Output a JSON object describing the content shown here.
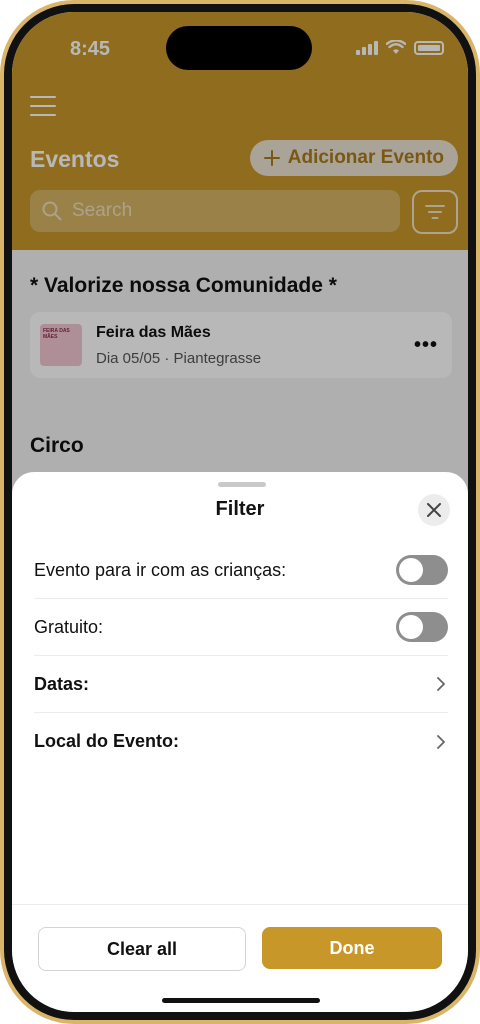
{
  "status_bar": {
    "time": "8:45"
  },
  "header": {
    "title": "Eventos",
    "add_button": "Adicionar Evento",
    "search_placeholder": "Search"
  },
  "sections": [
    {
      "title": "* Valorize nossa Comunidade *",
      "events": [
        {
          "name": "Feira das Mães",
          "meta": "Dia 05/05 · Piantegrasse",
          "thumb_text": "FEIRA DAS MÃES"
        }
      ]
    },
    {
      "title": "Circo"
    }
  ],
  "filter_sheet": {
    "title": "Filter",
    "rows": [
      {
        "label": "Evento para ir com as crianças:",
        "type": "toggle",
        "on": false
      },
      {
        "label": "Gratuito:",
        "type": "toggle",
        "on": false
      },
      {
        "label": "Datas:",
        "type": "disclosure"
      },
      {
        "label": "Local do Evento:",
        "type": "disclosure"
      }
    ],
    "clear_button": "Clear all",
    "done_button": "Done"
  },
  "colors": {
    "accent": "#c8972a"
  },
  "icons": [
    "menu-icon",
    "plus-icon",
    "search-icon",
    "filter-icon",
    "more-icon",
    "close-icon",
    "chevron-right-icon",
    "wifi-icon",
    "signal-icon",
    "battery-icon"
  ]
}
